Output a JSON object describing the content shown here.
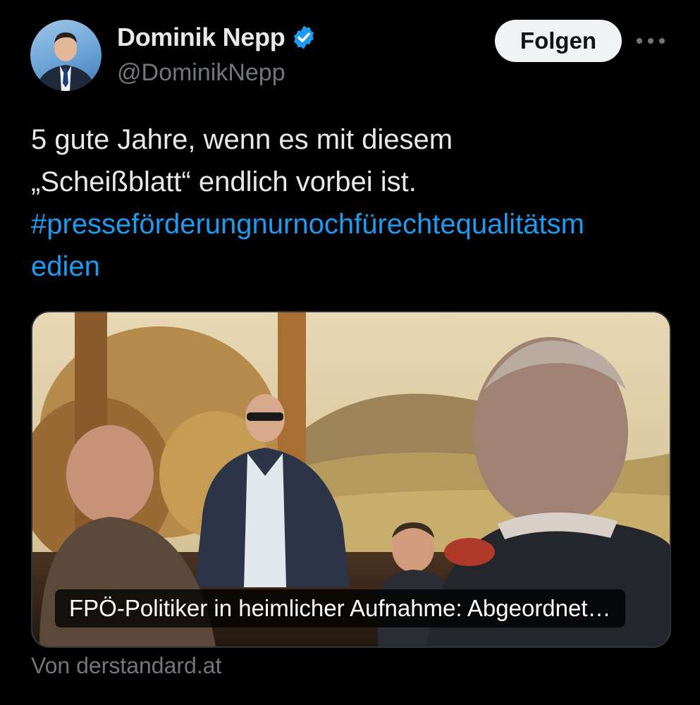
{
  "author": {
    "name": "Dominik Nepp",
    "handle": "@DominikNepp",
    "verified_icon": "verified-badge-icon"
  },
  "actions": {
    "follow_label": "Folgen",
    "more_icon": "more-icon"
  },
  "tweet": {
    "line1": "5 gute Jahre, wenn es mit diesem",
    "line2": "„Scheißblatt“ endlich vorbei ist.",
    "hashtag_line1": "#presseförderungnurnochfürechtequalitätsm",
    "hashtag_line2": "edien"
  },
  "link_card": {
    "headline": "FPÖ-Politiker in heimlicher Aufnahme: Abgeordnet…",
    "source": "Von derstandard.at"
  },
  "colors": {
    "background": "#000000",
    "text": "#e7e9ea",
    "secondary": "#71767b",
    "link": "#1d9bf0",
    "verified": "#1d9bf0"
  }
}
